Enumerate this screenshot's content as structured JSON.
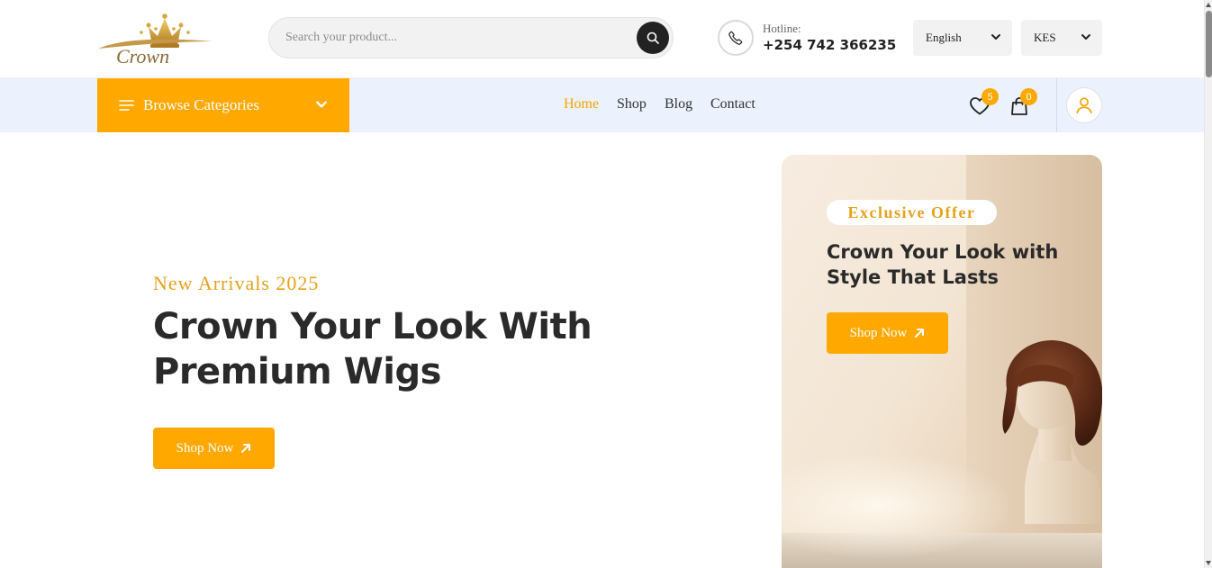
{
  "brand": {
    "logo_text": "Crown",
    "accent": "#ffa800",
    "dark": "#222222",
    "nav_bg": "#ebf2fd"
  },
  "header": {
    "search": {
      "placeholder": "Search your product...",
      "icon": "search-icon"
    },
    "hotline": {
      "label": "Hotline:",
      "number": "+254 742 366235",
      "icon": "phone-icon"
    },
    "language": {
      "selected": "English",
      "icon": "chevron-down-icon"
    },
    "currency": {
      "selected": "KES",
      "icon": "chevron-down-icon"
    }
  },
  "nav": {
    "browse_label": "Browse Categories",
    "links": [
      {
        "label": "Home",
        "active": true
      },
      {
        "label": "Shop",
        "active": false
      },
      {
        "label": "Blog",
        "active": false
      },
      {
        "label": "Contact",
        "active": false
      }
    ],
    "wishlist_count": "5",
    "cart_count": "0",
    "icons": [
      "menu-icon",
      "heart-icon",
      "bag-icon",
      "user-icon"
    ]
  },
  "hero": {
    "subtitle": "New Arrivals 2025",
    "title": "Crown Your Look With Premium Wigs",
    "button_label": "Shop Now",
    "button_icon": "arrow-up-right-icon"
  },
  "promo": {
    "badge": "Exclusive Offer",
    "title": "Crown Your Look with Style That Lasts",
    "button_label": "Shop Now",
    "image": "wig-on-mannequin"
  }
}
